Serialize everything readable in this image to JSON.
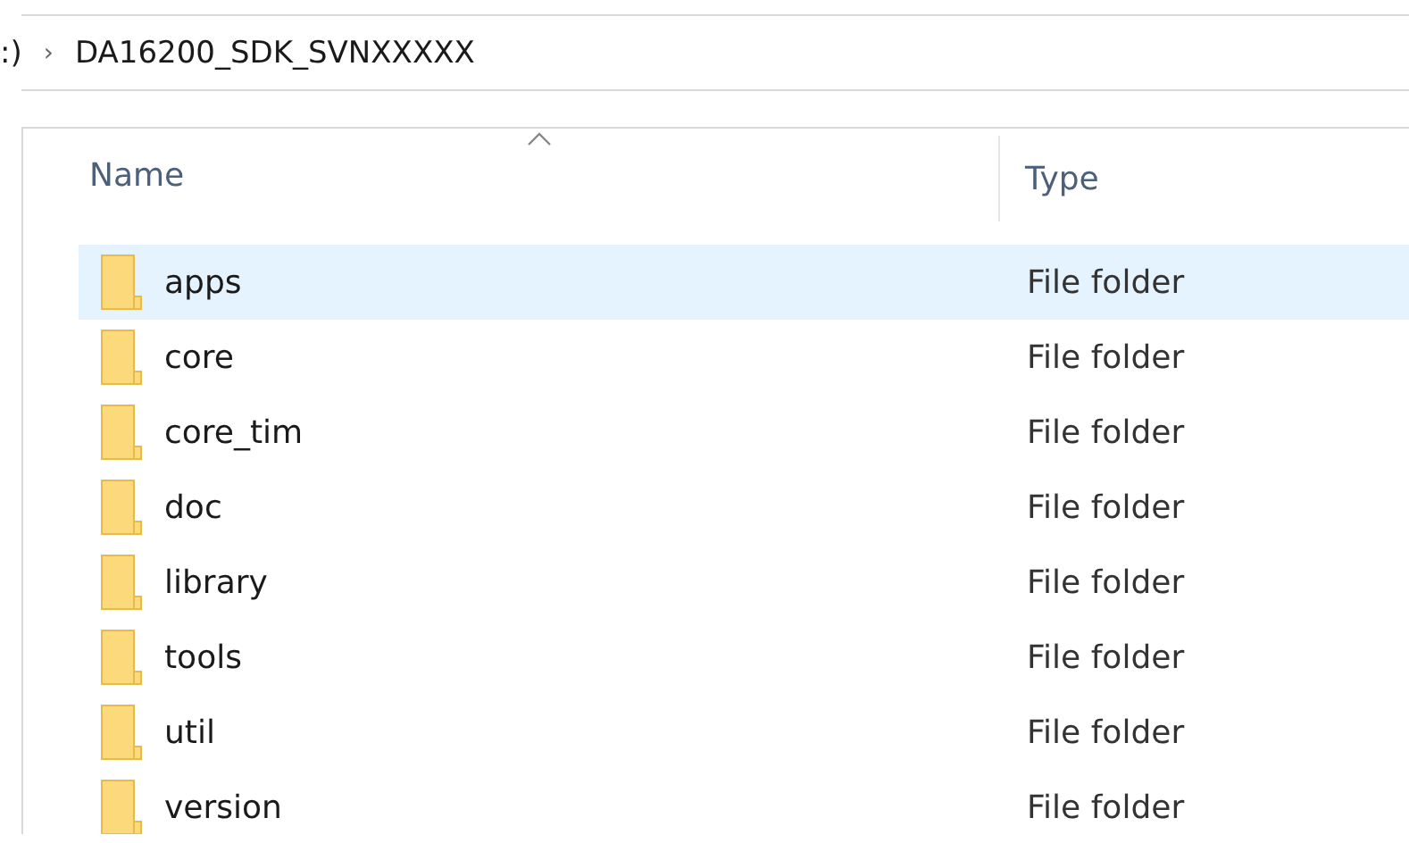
{
  "address_bar": {
    "path": [
      {
        "label": ":)"
      },
      {
        "label": "DA16200_SDK_SVNXXXXX"
      }
    ],
    "separator": "›"
  },
  "file_list": {
    "columns": [
      {
        "label": "Name",
        "sorted": true
      },
      {
        "label": "Type",
        "sorted": false
      }
    ],
    "rows": [
      {
        "name": "apps",
        "type": "File folder",
        "selected": true
      },
      {
        "name": "core",
        "type": "File folder",
        "selected": false
      },
      {
        "name": "core_tim",
        "type": "File folder",
        "selected": false
      },
      {
        "name": "doc",
        "type": "File folder",
        "selected": false
      },
      {
        "name": "library",
        "type": "File folder",
        "selected": false
      },
      {
        "name": "tools",
        "type": "File folder",
        "selected": false
      },
      {
        "name": "util",
        "type": "File folder",
        "selected": false
      },
      {
        "name": "version",
        "type": "File folder",
        "selected": false
      }
    ]
  }
}
